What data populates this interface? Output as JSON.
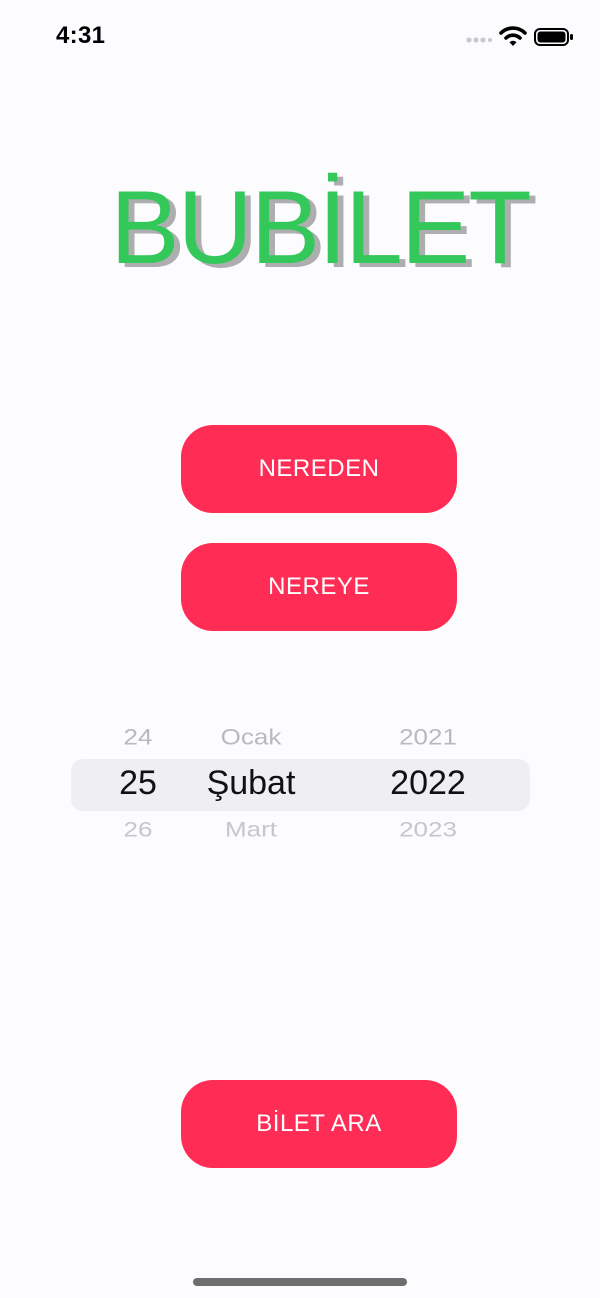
{
  "status_bar": {
    "time": "4:31"
  },
  "brand": {
    "title": "BUBİLET",
    "color": "#34c759"
  },
  "buttons": {
    "from_label": "NEREDEN",
    "to_label": "NEREYE",
    "search_label": "BİLET ARA",
    "color": "#ff2d55"
  },
  "date_picker": {
    "day": {
      "prev": "24",
      "selected": "25",
      "next": "26"
    },
    "month": {
      "prev": "Ocak",
      "selected": "Şubat",
      "next": "Mart"
    },
    "year": {
      "prev": "2021",
      "selected": "2022",
      "next": "2023"
    }
  },
  "icons": [
    "cellular-signal-icon",
    "wifi-icon",
    "battery-icon"
  ]
}
